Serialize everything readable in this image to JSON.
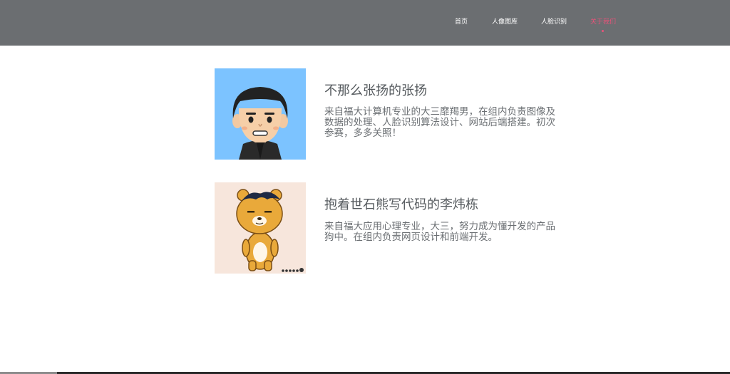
{
  "nav": {
    "items": [
      {
        "label": "首页"
      },
      {
        "label": "人像图库"
      },
      {
        "label": "人脸识别"
      },
      {
        "label": "关于我们"
      }
    ],
    "active_color": "#e8537a",
    "bar_color": "#6b6e71"
  },
  "members": [
    {
      "name": "不那么张扬的张扬",
      "description": "来自福大计算机专业的大三靡羯男，在组内负责图像及数据的处理、人脸识别算法设计、网站后端搭建。初次参赛，多多关照！",
      "avatar_icon": "cartoon-boy-avatar-icon",
      "avatar_bg": "#7cc3ff"
    },
    {
      "name": "抱着世石熊写代码的李炜栋",
      "description": "来自福大应用心理专业，大三，努力成为懂开发的产品狗中。在组内负责网页设计和前端开发。",
      "avatar_icon": "cartoon-bear-avatar-icon",
      "avatar_bg": "#f7e6dc"
    }
  ]
}
